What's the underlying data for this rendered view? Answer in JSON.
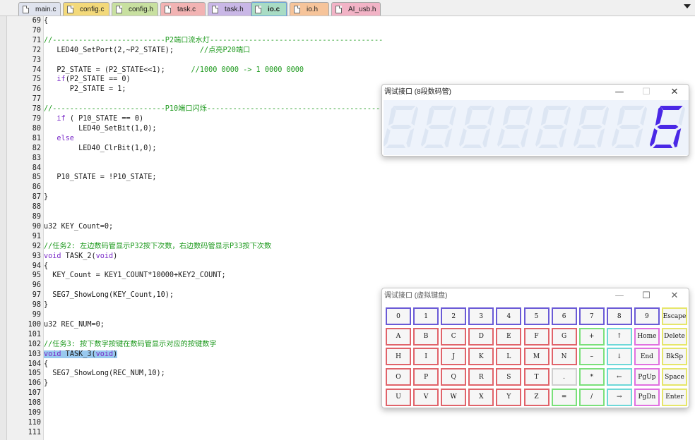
{
  "tabs": [
    {
      "label": "main.c",
      "color": "#dfe3ee",
      "active": false
    },
    {
      "label": "config.c",
      "color": "#f3d97a",
      "active": false
    },
    {
      "label": "config.h",
      "color": "#c8e0a0",
      "active": false
    },
    {
      "label": "task.c",
      "color": "#f2b3b3",
      "active": false
    },
    {
      "label": "task.h",
      "color": "#c9b7e6",
      "active": false
    },
    {
      "label": "io.c",
      "color": "#a8dcc4",
      "active": true
    },
    {
      "label": "io.h",
      "color": "#f6c49a",
      "active": false
    },
    {
      "label": "AI_usb.h",
      "color": "#f2b3c6",
      "active": false
    }
  ],
  "code_lines": [
    {
      "n": "69",
      "segs": [
        {
          "t": "{",
          "c": "def"
        }
      ]
    },
    {
      "n": "70",
      "segs": []
    },
    {
      "n": "71",
      "segs": [
        {
          "t": "//--------------------------P2端口流水灯----------------------------------------",
          "c": "cmt"
        }
      ]
    },
    {
      "n": "72",
      "segs": [
        {
          "t": "   LED40_SetPort(2,~P2_STATE);      ",
          "c": "def"
        },
        {
          "t": "//点亮P20端口",
          "c": "cmt"
        }
      ]
    },
    {
      "n": "73",
      "segs": []
    },
    {
      "n": "74",
      "segs": [
        {
          "t": "   P2_STATE = (P2_STATE<<1);      ",
          "c": "def"
        },
        {
          "t": "//1000 0000 -> 1 0000 0000",
          "c": "cmt"
        }
      ]
    },
    {
      "n": "75",
      "segs": [
        {
          "t": "   ",
          "c": "def"
        },
        {
          "t": "if",
          "c": "kw"
        },
        {
          "t": "(P2_STATE == 0)",
          "c": "def"
        }
      ]
    },
    {
      "n": "76",
      "segs": [
        {
          "t": "      P2_STATE = 1;",
          "c": "def"
        }
      ]
    },
    {
      "n": "77",
      "segs": []
    },
    {
      "n": "78",
      "segs": [
        {
          "t": "//--------------------------P10端口闪烁--------------------------------------------",
          "c": "cmt"
        }
      ]
    },
    {
      "n": "79",
      "segs": [
        {
          "t": "   ",
          "c": "def"
        },
        {
          "t": "if",
          "c": "kw"
        },
        {
          "t": " ( P10_STATE == 0)",
          "c": "def"
        }
      ]
    },
    {
      "n": "80",
      "segs": [
        {
          "t": "        LED40_SetBit(1,0);",
          "c": "def"
        }
      ]
    },
    {
      "n": "81",
      "segs": [
        {
          "t": "   ",
          "c": "def"
        },
        {
          "t": "else",
          "c": "kw"
        }
      ]
    },
    {
      "n": "82",
      "segs": [
        {
          "t": "        LED40_ClrBit(1,0);",
          "c": "def"
        }
      ]
    },
    {
      "n": "83",
      "segs": []
    },
    {
      "n": "84",
      "segs": []
    },
    {
      "n": "85",
      "segs": [
        {
          "t": "   P10_STATE = !P10_STATE;",
          "c": "def"
        }
      ]
    },
    {
      "n": "86",
      "segs": []
    },
    {
      "n": "87",
      "segs": [
        {
          "t": "}",
          "c": "def"
        }
      ]
    },
    {
      "n": "88",
      "segs": []
    },
    {
      "n": "89",
      "segs": []
    },
    {
      "n": "90",
      "segs": [
        {
          "t": "u32 KEY_Count=0;",
          "c": "def"
        }
      ]
    },
    {
      "n": "91",
      "segs": []
    },
    {
      "n": "92",
      "segs": [
        {
          "t": "//任务2: 左边数码管显示P32按下次数，右边数码管显示P33按下次数",
          "c": "cmt"
        }
      ]
    },
    {
      "n": "93",
      "segs": [
        {
          "t": "void",
          "c": "kw"
        },
        {
          "t": " TASK_2(",
          "c": "def"
        },
        {
          "t": "void",
          "c": "kw"
        },
        {
          "t": ")",
          "c": "def"
        }
      ]
    },
    {
      "n": "94",
      "segs": [
        {
          "t": "{",
          "c": "def"
        }
      ]
    },
    {
      "n": "95",
      "segs": [
        {
          "t": "  KEY_Count = KEY1_COUNT*10000+KEY2_COUNT;",
          "c": "def"
        }
      ]
    },
    {
      "n": "96",
      "segs": []
    },
    {
      "n": "97",
      "segs": [
        {
          "t": "  SEG7_ShowLong(KEY_Count,10);",
          "c": "def"
        }
      ]
    },
    {
      "n": "98",
      "segs": [
        {
          "t": "}",
          "c": "def"
        }
      ]
    },
    {
      "n": "99",
      "segs": []
    },
    {
      "n": "100",
      "segs": [
        {
          "t": "u32 REC_NUM=0;",
          "c": "def"
        }
      ]
    },
    {
      "n": "101",
      "segs": []
    },
    {
      "n": "102",
      "segs": [
        {
          "t": "//任务3: 按下数字按键在数码管显示对应的按键数字",
          "c": "cmt"
        }
      ]
    },
    {
      "n": "103",
      "segs": [
        {
          "t": "void",
          "c": "kw",
          "sel": true
        },
        {
          "t": " TASK_3(",
          "c": "def",
          "sel": true
        },
        {
          "t": "void",
          "c": "kw",
          "sel": true
        },
        {
          "t": ")",
          "c": "def",
          "sel": true
        }
      ]
    },
    {
      "n": "104",
      "segs": [
        {
          "t": "{",
          "c": "def"
        }
      ]
    },
    {
      "n": "105",
      "segs": [
        {
          "t": "  SEG7_ShowLong(REC_NUM,10);",
          "c": "def"
        }
      ]
    },
    {
      "n": "106",
      "segs": [
        {
          "t": "}",
          "c": "def"
        }
      ]
    },
    {
      "n": "107",
      "segs": []
    },
    {
      "n": "108",
      "segs": []
    },
    {
      "n": "109",
      "segs": []
    },
    {
      "n": "110",
      "segs": []
    },
    {
      "n": "111",
      "segs": []
    }
  ],
  "seg_window": {
    "title": "调试接口 (8段数码管)",
    "minimize": "—",
    "maximize": "☐",
    "close": "✕",
    "digits": [
      "8",
      "8",
      "8",
      "8",
      "8",
      "8",
      "8",
      "6"
    ],
    "lit": [
      false,
      false,
      false,
      false,
      false,
      false,
      false,
      true
    ],
    "color_lit": "#4a28e6",
    "color_dim": "#dde6f3"
  },
  "kbd_window": {
    "title": "调试接口 (虚拟键盘)",
    "minimize": "—",
    "maximize": "☐",
    "close": "✕",
    "rows": [
      [
        {
          "l": "0",
          "s": "blue"
        },
        {
          "l": "1",
          "s": "blue"
        },
        {
          "l": "2",
          "s": "blue"
        },
        {
          "l": "3",
          "s": "blue"
        },
        {
          "l": "4",
          "s": "blue"
        },
        {
          "l": "5",
          "s": "blue"
        },
        {
          "l": "6",
          "s": "blue"
        },
        {
          "l": "7",
          "s": "blue"
        },
        {
          "l": "8",
          "s": "blue"
        },
        {
          "l": "9",
          "s": "blue"
        },
        {
          "l": "Escape",
          "s": "yellow"
        }
      ],
      [
        {
          "l": "A",
          "s": "red"
        },
        {
          "l": "B",
          "s": "red"
        },
        {
          "l": "C",
          "s": "red"
        },
        {
          "l": "D",
          "s": "red"
        },
        {
          "l": "E",
          "s": "red"
        },
        {
          "l": "F",
          "s": "red"
        },
        {
          "l": "G",
          "s": "red"
        },
        {
          "l": "+",
          "s": "green"
        },
        {
          "l": "↑",
          "s": "cyan"
        },
        {
          "l": "Home",
          "s": "magenta"
        },
        {
          "l": "Delete",
          "s": "yellow"
        }
      ],
      [
        {
          "l": "H",
          "s": "red"
        },
        {
          "l": "I",
          "s": "red"
        },
        {
          "l": "J",
          "s": "red"
        },
        {
          "l": "K",
          "s": "red"
        },
        {
          "l": "L",
          "s": "red"
        },
        {
          "l": "M",
          "s": "red"
        },
        {
          "l": "N",
          "s": "red"
        },
        {
          "l": "–",
          "s": "green"
        },
        {
          "l": "↓",
          "s": "cyan"
        },
        {
          "l": "End",
          "s": "magenta"
        },
        {
          "l": "BkSp",
          "s": "yellow"
        }
      ],
      [
        {
          "l": "O",
          "s": "red"
        },
        {
          "l": "P",
          "s": "red"
        },
        {
          "l": "Q",
          "s": "red"
        },
        {
          "l": "R",
          "s": "red"
        },
        {
          "l": "S",
          "s": "red"
        },
        {
          "l": "T",
          "s": "red"
        },
        {
          "l": ".",
          "s": "gray"
        },
        {
          "l": "*",
          "s": "green"
        },
        {
          "l": "←",
          "s": "cyan"
        },
        {
          "l": "PgUp",
          "s": "magenta"
        },
        {
          "l": "Space",
          "s": "yellow"
        }
      ],
      [
        {
          "l": "U",
          "s": "red"
        },
        {
          "l": "V",
          "s": "red"
        },
        {
          "l": "W",
          "s": "red"
        },
        {
          "l": "X",
          "s": "red"
        },
        {
          "l": "Y",
          "s": "red"
        },
        {
          "l": "Z",
          "s": "red"
        },
        {
          "l": "=",
          "s": "green"
        },
        {
          "l": "/",
          "s": "green"
        },
        {
          "l": "→",
          "s": "cyan"
        },
        {
          "l": "PgDn",
          "s": "magenta"
        },
        {
          "l": "Enter",
          "s": "yellow"
        }
      ]
    ]
  }
}
